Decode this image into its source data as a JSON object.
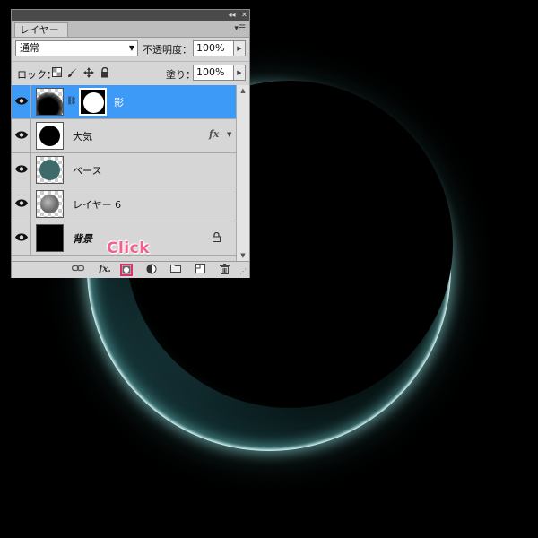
{
  "panel": {
    "tab_label": "レイヤー",
    "titlebar_buttons": [
      "◂◂",
      "✕"
    ],
    "menu_icon": "panel-menu-icon"
  },
  "blend": {
    "mode": "通常"
  },
  "opacity": {
    "label": "不透明度：",
    "value": "100%"
  },
  "lock": {
    "label": "ロック：",
    "icons": [
      "lock-transparent-icon",
      "lock-brush-icon",
      "lock-move-icon",
      "lock-all-icon"
    ]
  },
  "fill": {
    "label": "塗り：",
    "value": "100%"
  },
  "layers": [
    {
      "name": "影",
      "selected": true,
      "has_mask": true
    },
    {
      "name": "大気",
      "selected": false,
      "fx": "fx"
    },
    {
      "name": "ベース",
      "selected": false
    },
    {
      "name": "レイヤー 6",
      "selected": false
    },
    {
      "name": "背景",
      "selected": false,
      "locked": true
    }
  ],
  "bottom_bar": {
    "icons": [
      "link-icon",
      "fx-icon",
      "add-mask-icon",
      "adjustment-icon",
      "folder-icon",
      "new-layer-icon",
      "trash-icon"
    ],
    "fx_text": "fx."
  },
  "annotation": {
    "text": "Click",
    "color": "#e0306a"
  },
  "colors": {
    "selected_row": "#3d9bf7",
    "planet_glow": "#9ee0e0",
    "base_layer": "#3f6a6a"
  }
}
